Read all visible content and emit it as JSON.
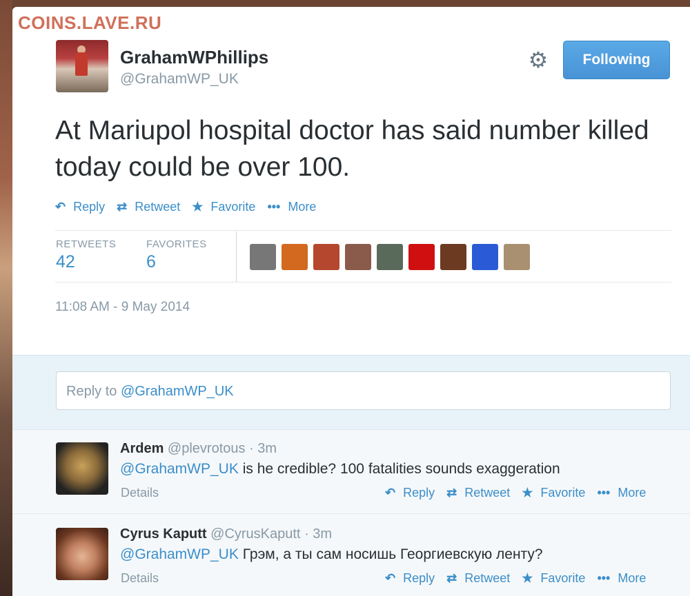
{
  "watermark": "COINS.LAVE.RU",
  "tweet": {
    "display_name": "GrahamWPhillips",
    "handle": "@GrahamWP_UK",
    "follow_label": "Following",
    "text": "At Mariupol hospital doctor has said number killed today could be over 100.",
    "actions": {
      "reply": "Reply",
      "retweet": "Retweet",
      "favorite": "Favorite",
      "more": "More"
    },
    "stats": {
      "retweets_label": "RETWEETS",
      "retweets_value": "42",
      "favorites_label": "FAVORITES",
      "favorites_value": "6"
    },
    "favoriters_colors": [
      "#777777",
      "#d2691e",
      "#b5472f",
      "#8a5a4a",
      "#5a6a5a",
      "#d01010",
      "#6b3a20",
      "#2a5ad6",
      "#a89070"
    ],
    "timestamp": "11:08 AM - 9 May 2014"
  },
  "reply_box": {
    "prefix": "Reply to ",
    "mention": "@GrahamWP_UK"
  },
  "replies": [
    {
      "name": "Ardem",
      "handle": "@plevrotous",
      "time": "3m",
      "mention": "@GrahamWP_UK",
      "text": " is he credible? 100 fatalities sounds exaggeration",
      "details": "Details",
      "reply": "Reply",
      "retweet": "Retweet",
      "favorite": "Favorite",
      "more": "More"
    },
    {
      "name": "Cyrus Kaputt",
      "handle": "@CyrusKaputt",
      "time": "3m",
      "mention": "@GrahamWP_UK",
      "text": " Грэм, а ты сам носишь Георгиевскую ленту?",
      "details": "Details",
      "reply": "Reply",
      "retweet": "Retweet",
      "favorite": "Favorite",
      "more": "More"
    }
  ],
  "colors": {
    "link": "#3b8ec9",
    "muted": "#8899a6",
    "text": "#292f33",
    "follow_button": "#4893d6"
  }
}
